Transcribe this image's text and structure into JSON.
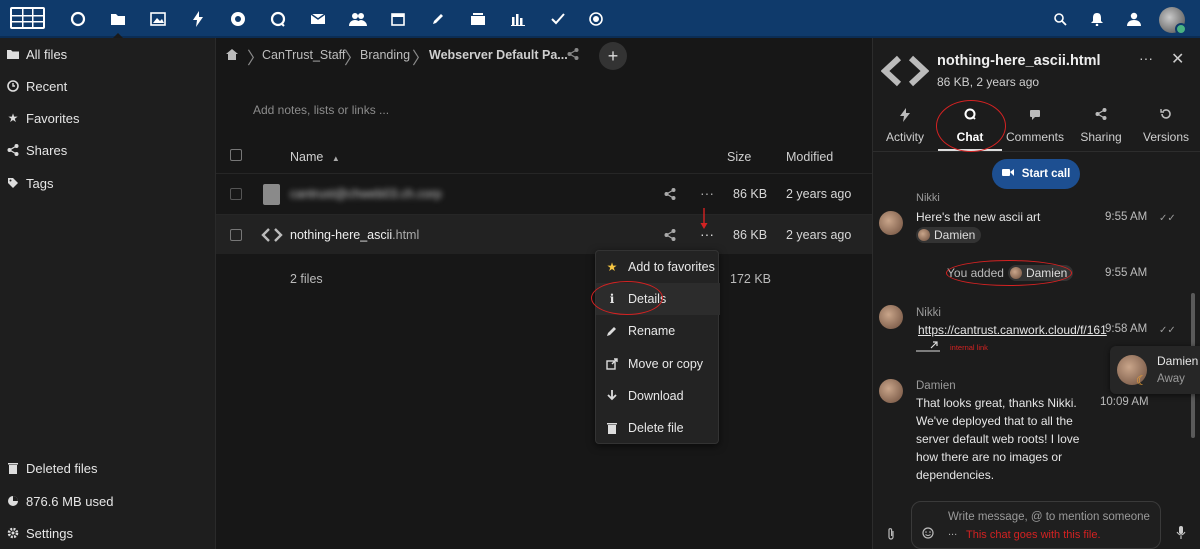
{
  "topbar": {
    "apps": [
      "dashboard-icon",
      "files-icon",
      "photos-icon",
      "activity-icon",
      "circles-icon",
      "talk-icon",
      "mail-icon",
      "contacts-icon",
      "calendar-icon",
      "notes-icon",
      "deck-icon",
      "analytics-icon",
      "tasks-icon",
      "settings-icon"
    ],
    "right_icons": [
      "search-icon",
      "bell-icon",
      "contacts-menu-icon",
      "user-avatar"
    ]
  },
  "sidebar": {
    "items": [
      {
        "label": "All files",
        "icon": "folder-icon"
      },
      {
        "label": "Recent",
        "icon": "clock-icon"
      },
      {
        "label": "Favorites",
        "icon": "star-icon"
      },
      {
        "label": "Shares",
        "icon": "share-icon"
      },
      {
        "label": "Tags",
        "icon": "tag-icon"
      }
    ],
    "bottom": [
      {
        "label": "Deleted files",
        "icon": "trash-icon"
      },
      {
        "label": "876.6 MB used",
        "icon": "pie-icon"
      },
      {
        "label": "Settings",
        "icon": "gear-icon"
      }
    ]
  },
  "breadcrumb": {
    "items": [
      "CanTrust_Staff",
      "Branding",
      "Webserver Default Pa..."
    ]
  },
  "notes_placeholder": "Add notes, lists or links ...",
  "table": {
    "headers": {
      "name": "Name",
      "size": "Size",
      "modified": "Modified"
    },
    "rows": [
      {
        "name": "cantrust@chweb03.ch.corp",
        "ext": "",
        "size": "86 KB",
        "modified": "2 years ago"
      },
      {
        "name": "nothing-here_ascii",
        "ext": ".html",
        "size": "86 KB",
        "modified": "2 years ago"
      }
    ],
    "summary": {
      "count": "2 files",
      "size": "172 KB"
    }
  },
  "context_menu": {
    "items": [
      {
        "label": "Add to favorites",
        "icon": "star-icon"
      },
      {
        "label": "Details",
        "icon": "info-icon"
      },
      {
        "label": "Rename",
        "icon": "pencil-icon"
      },
      {
        "label": "Move or copy",
        "icon": "external-icon"
      },
      {
        "label": "Download",
        "icon": "download-icon"
      },
      {
        "label": "Delete file",
        "icon": "trash-icon"
      }
    ]
  },
  "details": {
    "filename": "nothing-here_ascii.html",
    "meta": "86 KB, 2 years ago",
    "tabs": [
      "Activity",
      "Chat",
      "Comments",
      "Sharing",
      "Versions"
    ],
    "start_call": "Start call",
    "messages": [
      {
        "author": "Nikki",
        "text": "Here's the new ascii art",
        "mention": "Damien",
        "time": "9:55 AM"
      },
      {
        "system_prefix": "You added",
        "mention": "Damien",
        "time": "9:55 AM"
      },
      {
        "author": "Nikki",
        "link": "https://cantrust.canwork.cloud/f/161",
        "annotation": "internal link",
        "time": "9:58 AM"
      },
      {
        "author": "Damien",
        "text": "That looks great, thanks Nikki. We've deployed that to all the server default web roots!  I love how there are no images or dependencies.",
        "time": "10:09 AM"
      }
    ],
    "presence": {
      "name": "Damien",
      "status": "Away"
    },
    "composer_placeholder": "Write message, @ to mention someone",
    "composer_annotation": "This chat goes with this file."
  },
  "colors": {
    "accent": "#0f3a6b",
    "annotation_red": "#d42222"
  }
}
